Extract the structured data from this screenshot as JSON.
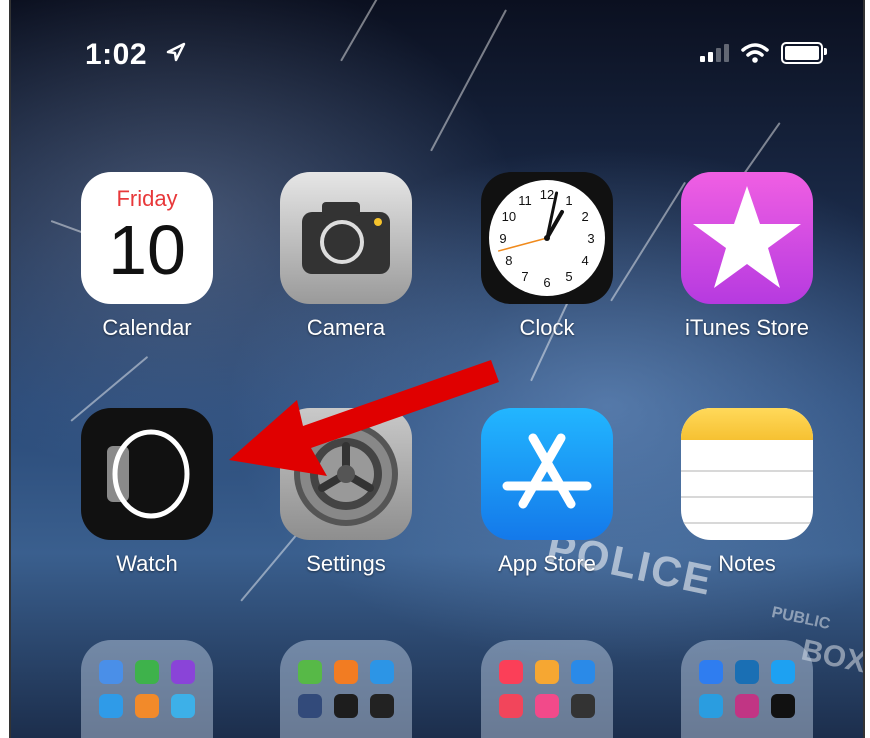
{
  "status_bar": {
    "time": "1:02",
    "battery_level": 0.9,
    "signal_bars_filled": 2,
    "signal_bars_total": 4
  },
  "apps": [
    {
      "name": "Calendar",
      "icon": "calendar-icon",
      "day": "Friday",
      "date": "10"
    },
    {
      "name": "Camera",
      "icon": "camera-icon"
    },
    {
      "name": "Clock",
      "icon": "clock-icon",
      "numbers": [
        "12",
        "1",
        "2",
        "3",
        "4",
        "5",
        "6",
        "7",
        "8",
        "9",
        "10",
        "11"
      ]
    },
    {
      "name": "iTunes Store",
      "icon": "star-icon"
    },
    {
      "name": "Watch",
      "icon": "watch-icon"
    },
    {
      "name": "Settings",
      "icon": "gear-icon"
    },
    {
      "name": "App Store",
      "icon": "app-store-icon"
    },
    {
      "name": "Notes",
      "icon": "notes-icon"
    }
  ],
  "colors": {
    "calendar_day": "#e8383a",
    "itunes": "#d14ae4",
    "appstore": "#1a8ff5",
    "notes_top": "#f6c132",
    "arrow": "#e00000"
  },
  "background_text": [
    "POLICE",
    "PUBLIC",
    "BOX"
  ]
}
